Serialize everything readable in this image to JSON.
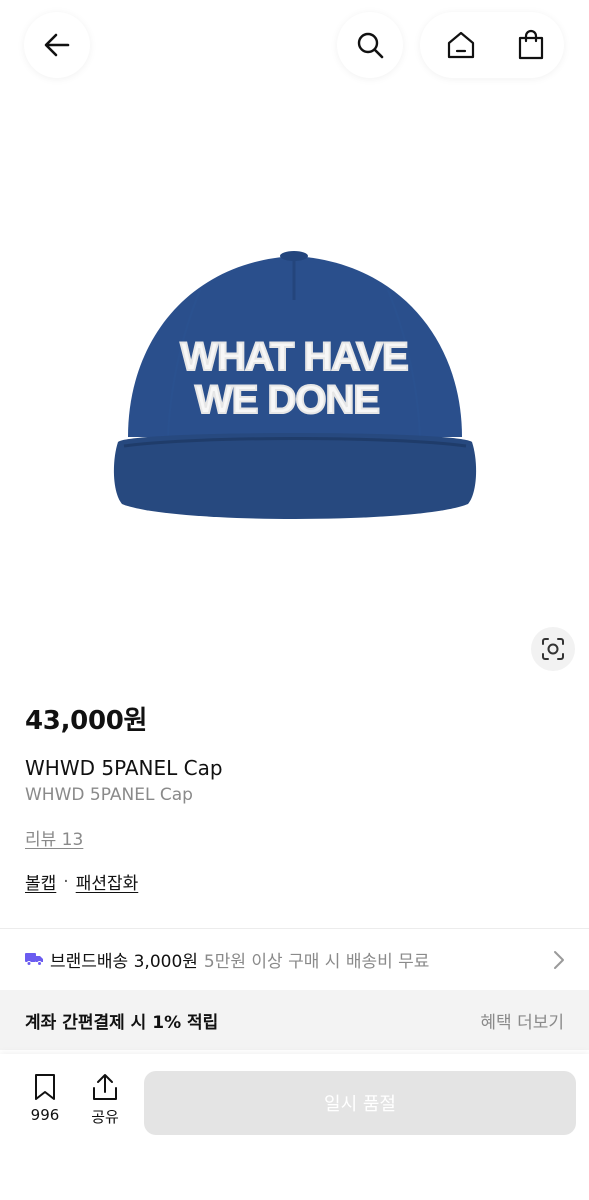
{
  "topbar": {
    "back_icon": "arrow-left-icon",
    "search_icon": "search-icon",
    "home_icon": "home-icon",
    "bag_icon": "shopping-bag-icon"
  },
  "product": {
    "image_text_line1": "WHAT HAVE",
    "image_text_line2": "WE DONE",
    "cap_color": "#2a4f8c",
    "price": "43,000원",
    "name": "WHWD 5PANEL Cap",
    "name_en": "WHWD 5PANEL Cap",
    "review": "리뷰 13",
    "brand": "볼캡",
    "category": "패션잡화",
    "category_separator": "·"
  },
  "shipping": {
    "label": "브랜드배송 3,000원",
    "note": "5만원 이상 구매 시 배송비 무료",
    "truck_color": "#6b5cf0"
  },
  "benefit": {
    "text": "계좌 간편결제 시 1% 적립",
    "more": "혜택 더보기"
  },
  "bottom": {
    "save_count": "996",
    "share_label": "공유",
    "soldout_label": "일시 품절"
  }
}
